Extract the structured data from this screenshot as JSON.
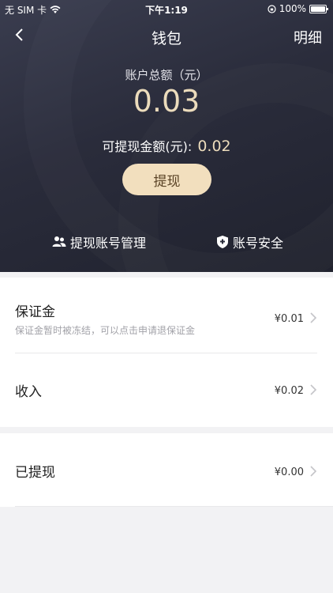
{
  "status_bar": {
    "carrier": "无 SIM 卡",
    "time": "下午1:19",
    "battery": "100%"
  },
  "nav": {
    "title": "钱包",
    "right_label": "明细",
    "back_icon": "chevron-left-icon"
  },
  "summary": {
    "total_label": "账户总额（元）",
    "total_value": "0.03",
    "withdrawable_label": "可提现金额(元):",
    "withdrawable_value": "0.02",
    "withdraw_button": "提现"
  },
  "links": {
    "account_manage": "提现账号管理",
    "account_security": "账号安全"
  },
  "rows": {
    "deposit": {
      "title": "保证金",
      "subtitle": "保证金暂时被冻结，可以点击申请退保证金",
      "value": "¥0.01"
    },
    "income": {
      "title": "收入",
      "value": "¥0.02"
    },
    "withdrawn": {
      "title": "已提现",
      "value": "¥0.00"
    }
  },
  "colors": {
    "hero_bg": "#2a2c3b",
    "gold_text": "#ecdcbc",
    "button_bg": "#f2dfbe",
    "page_bg": "#f2f2f4"
  }
}
